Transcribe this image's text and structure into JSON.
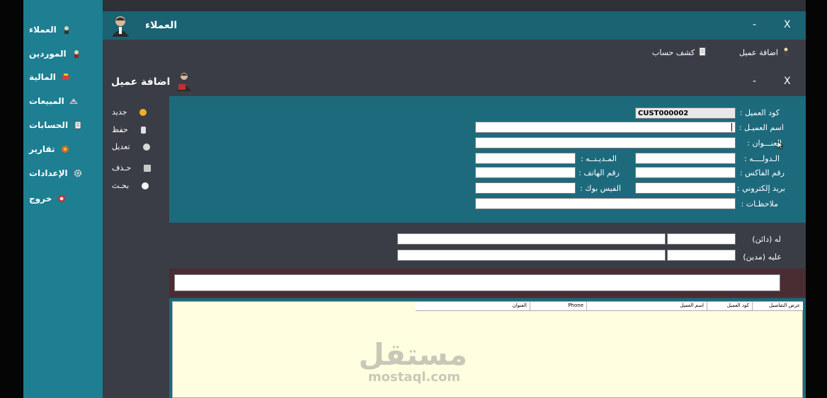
{
  "sidebar": {
    "items": [
      {
        "label": "العملاء",
        "icon": "person-icon"
      },
      {
        "label": "الموردين",
        "icon": "supplier-icon"
      },
      {
        "label": "المالية",
        "icon": "finance-icon"
      },
      {
        "label": "المبيعات",
        "icon": "sales-icon"
      },
      {
        "label": "الحسابات",
        "icon": "accounts-icon"
      },
      {
        "label": "تقارير",
        "icon": "reports-icon"
      },
      {
        "label": "الإعدادات",
        "icon": "gear-icon"
      },
      {
        "label": "خروج",
        "icon": "exit-icon"
      }
    ]
  },
  "customers_window": {
    "title": "العملاء",
    "minimize": "-",
    "close": "X"
  },
  "toolbar": {
    "add_customer": "اضافة عميل",
    "account_statement": "كشف حساب"
  },
  "add_customer_window": {
    "title": "اضافة عميل",
    "minimize": "-",
    "close": "X"
  },
  "actions": {
    "new": "جديد",
    "save": "حفظ",
    "edit": "تعديل",
    "delete": "حـذف",
    "search": "بحـث"
  },
  "form": {
    "customer_code_label": "كود العميل :",
    "customer_code_value": "CUST000002",
    "customer_name_label": "اسم العميـل :",
    "address_label": "العنـــوان :",
    "country_label": "الـدولــــه :",
    "city_label": "المـديـنــه :",
    "fax_label": "رقم الفاكس :",
    "phone_label": "رقم الهاتف :",
    "email_label": "بريد إلكتروني :",
    "facebook_label": "الفيس بوك :",
    "notes_label": "ملاحظـات :"
  },
  "balance": {
    "credit_label": "له (دائن)",
    "debit_label": "عليه (مدين)"
  },
  "grid": {
    "columns": [
      "عرض التفاصيل",
      "كود العميل",
      "اسم العميل",
      "Phone",
      "العنوان"
    ]
  },
  "watermark": {
    "arabic": "مستقل",
    "latin": "mostaql.com"
  }
}
